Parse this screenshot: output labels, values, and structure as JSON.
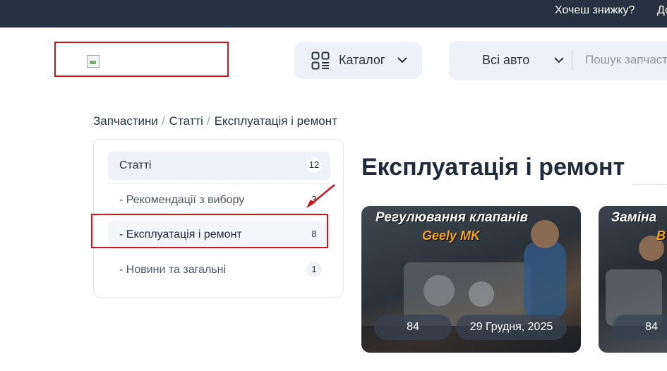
{
  "topbar": {
    "promo": "Хочеш знижку?",
    "more": "До"
  },
  "header": {
    "catalog_label": "Каталог",
    "auto_select": "Всі авто",
    "search_placeholder": "Пошук запчастин"
  },
  "breadcrumb": [
    "Запчастини",
    "Статті",
    "Експлуатація і ремонт"
  ],
  "sidebar": {
    "items": [
      {
        "label": "Статті",
        "count": "12"
      },
      {
        "label": "- Рекомендації з вибору",
        "count": "3"
      },
      {
        "label": "- Експлуатація і ремонт",
        "count": "8"
      },
      {
        "label": "- Новини та загальні",
        "count": "1"
      }
    ]
  },
  "main": {
    "title": "Експлуатація і ремонт",
    "cards": [
      {
        "line1": "Регулювання клапанів",
        "line2": "Geely MK",
        "views": "84",
        "date": "29 Грудня, 2025"
      },
      {
        "line1": "Заміна",
        "line2": "B",
        "views": "84"
      }
    ]
  },
  "colors": {
    "topbar": "#263241",
    "highlight": "#d0141c",
    "accent": "#f5a623"
  }
}
